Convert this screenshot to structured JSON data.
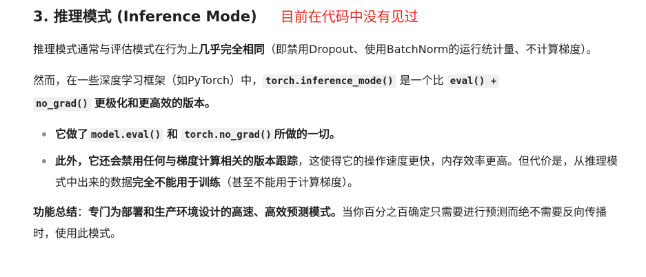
{
  "heading": {
    "title": "3. 推理模式 (Inference Mode)",
    "annotation": "目前在代码中没有见过"
  },
  "paragraph1": {
    "t1": "推理模式通常与评估模式在行为上",
    "b1": "几乎完全相同",
    "t2": "（即禁用Dropout、使用BatchNorm的运行统计量、不计算梯度）。"
  },
  "paragraph2": {
    "t1": "然而，在一些深度学习框架（如PyTorch）中，",
    "code1": "torch.inference_mode()",
    "t2": "是一个比",
    "code2a": "eval() +",
    "code2b": "no_grad()",
    "b1": "更极化和更高效的版本。"
  },
  "bullets": {
    "item1": {
      "b1": "它做了",
      "code1": "model.eval()",
      "b2": "和",
      "code2": "torch.no_grad()",
      "b3": "所做的一切。"
    },
    "item2": {
      "b1": "此外，它还会禁用任何与梯度计算相关的版本跟踪",
      "t1": "，这使得它的操作速度更快，内存效率更高。但代价是，从推理模式中出来的数据",
      "b2": "完全不能用于训练",
      "t2": "（甚至不能用于计算梯度）。"
    }
  },
  "summary": {
    "b1": "功能总结",
    "t1": "：",
    "b2": "专门为部署和生产环境设计的高速、高效预测模式。",
    "t2": "当你百分之百确定只需要进行预测而绝不需要反向传播时，使用此模式。"
  },
  "colors": {
    "annotation": "#e8251f",
    "code_bg": "#f0f0f0",
    "text": "#1f1f1f"
  }
}
